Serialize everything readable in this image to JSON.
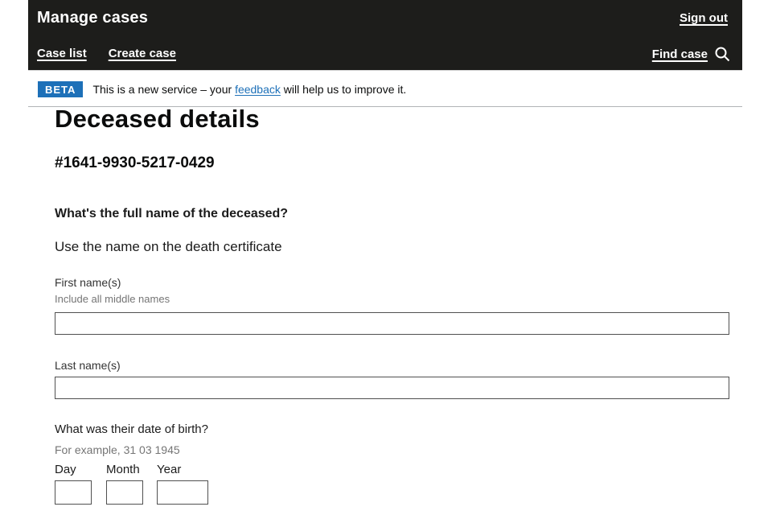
{
  "header": {
    "service_name": "Manage cases",
    "sign_out_label": "Sign out",
    "nav": {
      "case_list_label": "Case list",
      "create_case_label": "Create case",
      "find_case_label": "Find case"
    }
  },
  "phase_banner": {
    "tag": "BETA",
    "text_before": "This is a new service – your ",
    "link_label": "feedback",
    "text_after": " will help us to improve it."
  },
  "page": {
    "title": "Deceased details",
    "case_number": "#1641-9930-5217-0429"
  },
  "name_section": {
    "question": "What's the full name of the deceased?",
    "hint": "Use the name on the death certificate",
    "first_name": {
      "label": "First name(s)",
      "hint": "Include all middle names",
      "value": ""
    },
    "last_name": {
      "label": "Last name(s)",
      "value": ""
    }
  },
  "dob_section": {
    "question": "What was their date of birth?",
    "hint": "For example, 31 03 1945",
    "day_label": "Day",
    "month_label": "Month",
    "year_label": "Year",
    "day_value": "",
    "month_value": "",
    "year_value": ""
  },
  "colors": {
    "header_background": "#1d1d1b",
    "phase_tag_blue": "#1d70b8",
    "link_blue": "#1d70b8",
    "hint_gray": "#757575",
    "text_black": "#0b0c0c"
  }
}
